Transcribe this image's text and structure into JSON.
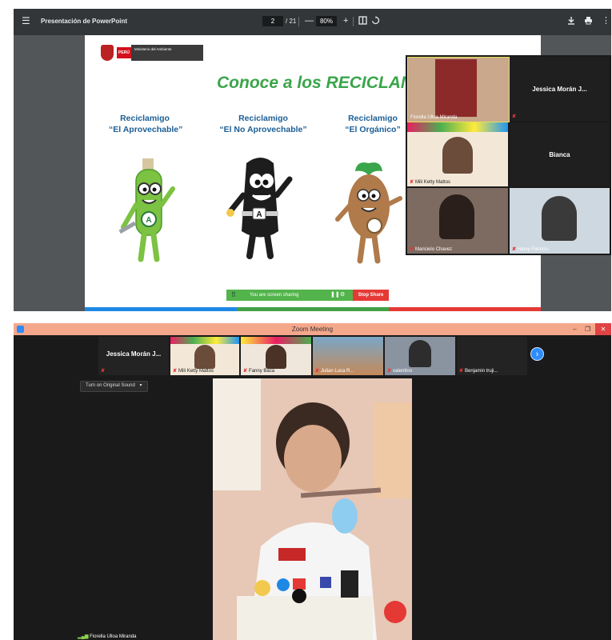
{
  "pdf_viewer": {
    "menu_icon": "menu-icon",
    "title": "Presentación de PowerPoint",
    "page_current": "2",
    "page_total": "/ 21",
    "zoom_minus": "—",
    "zoom_value": "80%",
    "zoom_plus": "+",
    "download_icon": "download-icon",
    "print_icon": "print-icon",
    "more_icon": "more-vertical-icon"
  },
  "slide": {
    "logo_peru": "PERÚ",
    "logo_ministry": "Ministerio del Ambiente",
    "title": "Conoce a los RECICLAMI",
    "mascots": [
      {
        "line1": "Reciclamigo",
        "line2": "“El Aprovechable”",
        "color": "#6cc04a"
      },
      {
        "line1": "Reciclamigo",
        "line2": "“El No Aprovechable”",
        "color": "#222222"
      },
      {
        "line1": "Reciclamigo",
        "line2": "“El Orgánico”",
        "color": "#b07a4a"
      }
    ],
    "share_bar_text": "You are screen sharing",
    "stop_share": "Stop Share",
    "bottom_colors": [
      "#1e88e5",
      "#43a047",
      "#e53935"
    ]
  },
  "top_gallery": {
    "tiles": [
      {
        "name": "Fiorella Ulloa Miranda"
      },
      {
        "name": "Jessica Morán J..."
      },
      {
        "name": "Mili Ketty Mattos"
      },
      {
        "name": "Bianca"
      },
      {
        "name": "Maricielo Chavez"
      },
      {
        "name": "Harvy Fabricio"
      }
    ]
  },
  "zoom": {
    "window_title": "Zoom Meeting",
    "win_min": "–",
    "win_max": "❐",
    "win_close": "✕",
    "strip": [
      {
        "name": "Jessica Morán J..."
      },
      {
        "name": "Mili Ketty Mattos"
      },
      {
        "name": "Fanny Baca"
      },
      {
        "name": "Julian Luca R..."
      },
      {
        "name": "valentino"
      },
      {
        "name": "Benjamin truji..."
      }
    ],
    "next_arrow": "›",
    "sound_button": "Turn on Original Sound",
    "sound_caret": "▾",
    "speaker_name": "Fiorella Ulloa Miranda"
  }
}
